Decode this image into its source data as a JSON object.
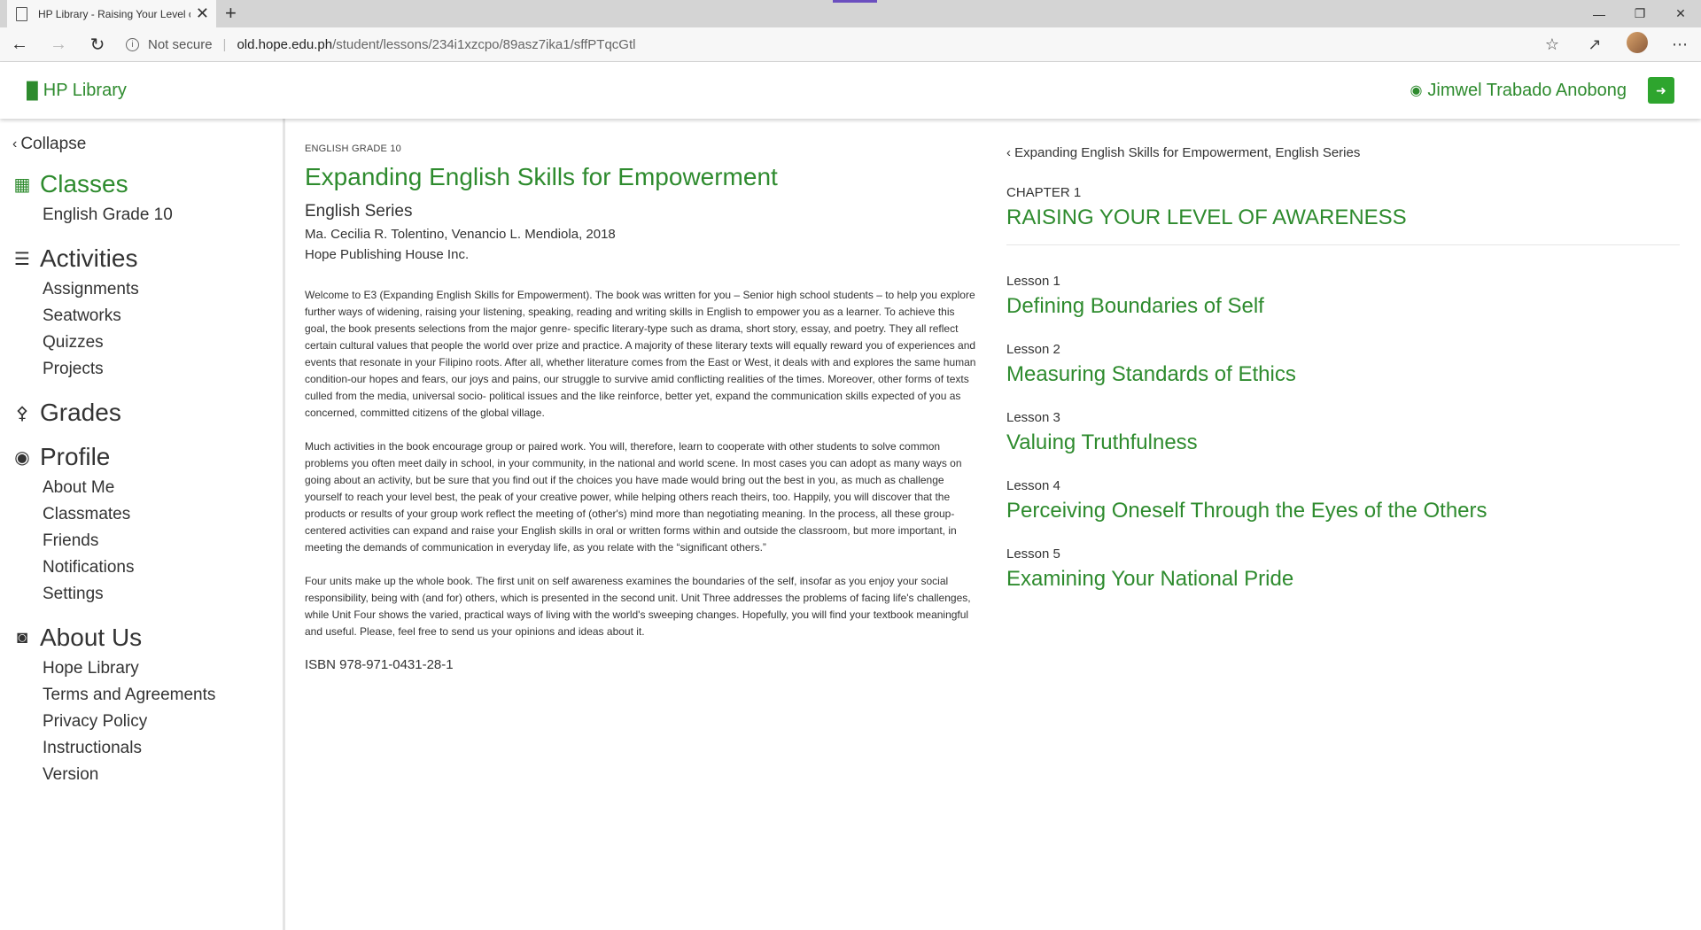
{
  "browser": {
    "tab_title": "HP Library - Raising Your Level of Awareness",
    "tab_close": "✕",
    "new_tab": "+",
    "not_secure": "Not secure",
    "url_domain": "old.hope.edu.ph",
    "url_path": "/student/lessons/234i1xzcpo/89asz7ika1/sffPTqcGtl"
  },
  "header": {
    "brand": "HP Library",
    "user_name": "Jimwel Trabado Anobong"
  },
  "sidebar": {
    "collapse": "Collapse",
    "sections": [
      {
        "label": "Classes",
        "icon": "book-open-icon",
        "items": [
          "English Grade 10"
        ]
      },
      {
        "label": "Activities",
        "icon": "list-icon",
        "items": [
          "Assignments",
          "Seatworks",
          "Quizzes",
          "Projects"
        ]
      },
      {
        "label": "Grades",
        "icon": "trophy-icon",
        "items": []
      },
      {
        "label": "Profile",
        "icon": "user-circle-icon",
        "items": [
          "About Me",
          "Classmates",
          "Friends",
          "Notifications",
          "Settings"
        ]
      },
      {
        "label": "About Us",
        "icon": "users-circle-icon",
        "items": [
          "Hope Library",
          "Terms and Agreements",
          "Privacy Policy",
          "Instructionals",
          "Version"
        ]
      }
    ]
  },
  "book": {
    "grade": "ENGLISH GRADE 10",
    "title": "Expanding English Skills for Empowerment",
    "series": "English Series",
    "authors": "Ma. Cecilia R. Tolentino, Venancio L. Mendiola, 2018",
    "publisher": "Hope Publishing House Inc.",
    "paragraphs": [
      "Welcome to E3 (Expanding English Skills for Empowerment). The book was written for you – Senior high school students – to help you explore further ways of widening, raising your listening, speaking, reading and writing skills in English to empower you as a learner. To achieve this goal, the book presents selections from the major genre- specific literary-type such as drama, short story, essay, and poetry. They all reflect certain cultural values that people the world over prize and practice. A majority of these literary texts will equally reward you of experiences and events that resonate in your Filipino roots. After all, whether literature comes from the East or West, it deals with and explores the same human condition-our hopes and fears, our joys and pains, our struggle to survive amid conflicting realities of the times. Moreover, other forms of texts culled from the media, universal socio- political issues and the like reinforce, better yet, expand the communication skills expected of you as concerned, committed citizens of the global village.",
      "Much activities in the book encourage group or paired work. You will, therefore, learn to cooperate with other students to solve common problems you often meet daily in school, in your community, in the national and world scene. In most cases you can adopt as many ways on going about an activity, but be sure that you find out if the choices you have made would bring out the best in you, as much as challenge yourself to reach your level best, the peak of your creative power, while helping others reach theirs, too. Happily, you will discover that the products or results of your group work reflect the meeting of (other's) mind more than negotiating meaning. In the process, all these group-centered activities can expand and raise your English skills in oral or written forms within and outside the classroom, but more important, in meeting the demands of communication in everyday life, as you relate with the “significant others.”",
      "Four units make up the whole book. The first unit on self awareness examines the boundaries of the self, insofar as you enjoy your social responsibility, being with (and for) others, which is presented in the second unit. Unit Three addresses the problems of facing life's challenges, while Unit Four shows the varied, practical ways of living with the world's sweeping changes. Hopefully, you will find your textbook meaningful and useful. Please, feel free to send us your opinions and ideas about it."
    ],
    "isbn": "ISBN 978-971-0431-28-1"
  },
  "chapter": {
    "back_link": "Expanding English Skills for Empowerment, English Series",
    "number": "CHAPTER 1",
    "title": "RAISING YOUR LEVEL OF AWARENESS",
    "lessons": [
      {
        "label": "Lesson 1",
        "title": "Defining Boundaries of Self"
      },
      {
        "label": "Lesson 2",
        "title": "Measuring Standards of Ethics"
      },
      {
        "label": "Lesson 3",
        "title": "Valuing Truthfulness"
      },
      {
        "label": "Lesson 4",
        "title": "Perceiving Oneself Through the Eyes of the Others"
      },
      {
        "label": "Lesson 5",
        "title": "Examining Your National Pride"
      }
    ]
  },
  "colors": {
    "accent": "#2e8b2e",
    "logout_button": "#2ea52e"
  }
}
